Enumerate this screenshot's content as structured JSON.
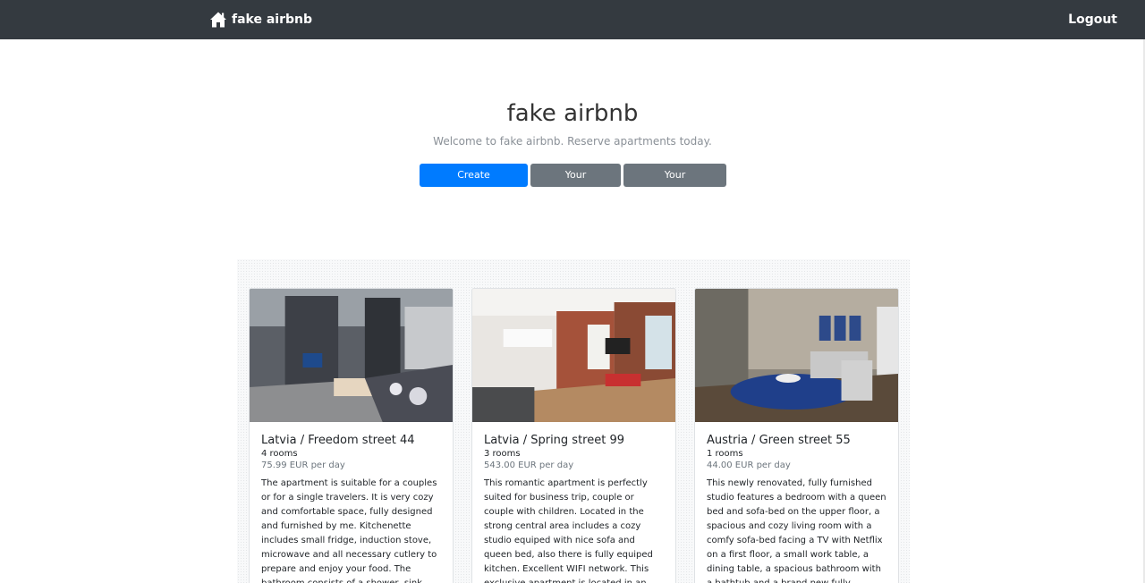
{
  "navbar": {
    "brand": "fake airbnb",
    "logout": "Logout"
  },
  "hero": {
    "title": "fake airbnb",
    "subtitle": "Welcome to fake airbnb. Reserve apartments today.",
    "buttons": {
      "create": "Create Advertisement",
      "reservations": "Your Reservations",
      "advertisements": "Your Advertisements"
    }
  },
  "listings": [
    {
      "title": "Latvia / Freedom street 44",
      "rooms": "4 rooms",
      "price": "75.99 EUR per day",
      "description": "The apartment is suitable for a couples or for a single travelers. It is very cozy and comfortable space, fully designed and furnished by me. Kitchenette includes small fridge, induction stove, microwave and all necessary cutlery to prepare and enjoy your food. The bathroom consists of a shower, sink with a big front"
    },
    {
      "title": "Latvia / Spring street 99",
      "rooms": "3 rooms",
      "price": "543.00 EUR per day",
      "description": "This romantic apartment is perfectly suited for business trip, couple or couple with children. Located in the strong central area includes a cozy studio equiped with nice sofa and queen bed, also there is fully equiped kitchen. Excellent WIFI network. This exclusive apartment is located in an interesting"
    },
    {
      "title": "Austria / Green street 55",
      "rooms": "1 rooms",
      "price": "44.00 EUR per day",
      "description": "This newly renovated, fully furnished studio features a bedroom with a queen bed and sofa-bed on the upper floor, a spacious and cozy living room with a comfy sofa-bed facing a TV with Netflix on a first floor, a small work table, a dining table, a spacious bathroom with a bathtub and a brand new fully equipped"
    }
  ],
  "colors": {
    "navbar": "#343a40",
    "primary": "#007bff",
    "secondary": "#6c757d"
  }
}
